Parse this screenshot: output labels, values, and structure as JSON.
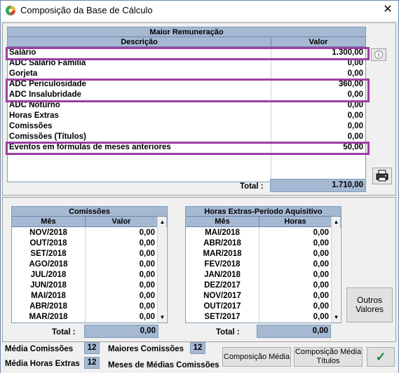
{
  "window": {
    "title": "Composição da Base de Cálculo",
    "close_glyph": "✕"
  },
  "main": {
    "header_title": "Maior Remuneração",
    "col_descricao": "Descrição",
    "col_valor": "Valor",
    "rows": [
      {
        "descricao": "Salário",
        "valor": "1.300,00"
      },
      {
        "descricao": "ADC Salário Família",
        "valor": "0,00"
      },
      {
        "descricao": "Gorjeta",
        "valor": "0,00"
      },
      {
        "descricao": "ADC Periculosidade",
        "valor": "360,00"
      },
      {
        "descricao": "ADC Insalubridade",
        "valor": "0,00"
      },
      {
        "descricao": "ADC Noturno",
        "valor": "0,00"
      },
      {
        "descricao": "Horas Extras",
        "valor": "0,00"
      },
      {
        "descricao": "Comissões",
        "valor": "0,00"
      },
      {
        "descricao": "Comissões (Títulos)",
        "valor": "0,00"
      },
      {
        "descricao": "Eventos em fórmulas de meses anteriores",
        "valor": "50,00"
      }
    ],
    "total_label": "Total :",
    "total_value": "1.710,00",
    "info_icon": "info-icon",
    "print_icon": "printer-icon",
    "highlight_color": "#9b3fa3"
  },
  "comissoes": {
    "title": "Comissões",
    "col_mes": "Mês",
    "col_valor": "Valor",
    "rows": [
      {
        "mes": "NOV/2018",
        "valor": "0,00"
      },
      {
        "mes": "OUT/2018",
        "valor": "0,00"
      },
      {
        "mes": "SET/2018",
        "valor": "0,00"
      },
      {
        "mes": "AGO/2018",
        "valor": "0,00"
      },
      {
        "mes": "JUL/2018",
        "valor": "0,00"
      },
      {
        "mes": "JUN/2018",
        "valor": "0,00"
      },
      {
        "mes": "MAI/2018",
        "valor": "0,00"
      },
      {
        "mes": "ABR/2018",
        "valor": "0,00"
      },
      {
        "mes": "MAR/2018",
        "valor": "0,00"
      }
    ],
    "total_label": "Total :",
    "total_value": "0,00"
  },
  "horas_extras": {
    "title": "Horas Extras-Período Aquisitivo",
    "col_mes": "Mês",
    "col_horas": "Horas",
    "rows": [
      {
        "mes": "MAI/2018",
        "horas": "0,00"
      },
      {
        "mes": "ABR/2018",
        "horas": "0,00"
      },
      {
        "mes": "MAR/2018",
        "horas": "0,00"
      },
      {
        "mes": "FEV/2018",
        "horas": "0,00"
      },
      {
        "mes": "JAN/2018",
        "horas": "0,00"
      },
      {
        "mes": "DEZ/2017",
        "horas": "0,00"
      },
      {
        "mes": "NOV/2017",
        "horas": "0,00"
      },
      {
        "mes": "OUT/2017",
        "horas": "0,00"
      },
      {
        "mes": "SET/2017",
        "horas": "0,00"
      }
    ],
    "total_label": "Total :",
    "total_value": "0,00"
  },
  "buttons": {
    "outros_valores": "Outros Valores",
    "composicao_media": "Composição Média",
    "composicao_media_titulos": "Composição Média Títulos",
    "confirm_glyph": "✓"
  },
  "stats": {
    "media_comissoes_label": "Média Comissões",
    "media_comissoes_value": "12",
    "maiores_comissoes_label": "Maiores Comissões",
    "maiores_comissoes_value": "12",
    "media_horas_extras_label": "Média Horas Extras",
    "media_horas_extras_value": "12",
    "meses_medias_label": "Meses de Médias Comissões"
  }
}
